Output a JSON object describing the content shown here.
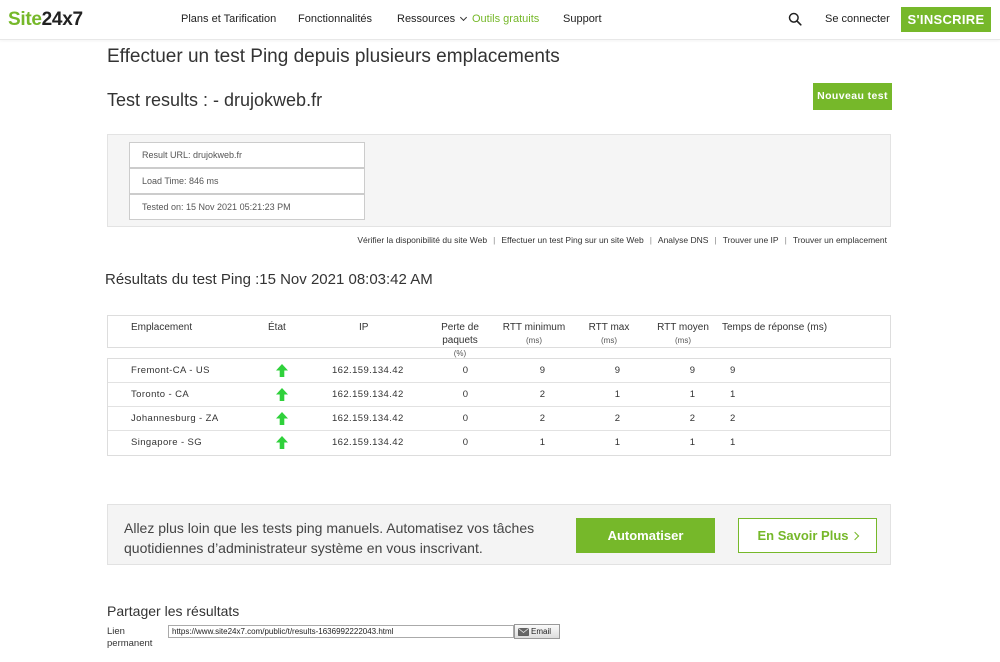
{
  "header": {
    "logo_part1": "Site",
    "logo_part2": "24x7",
    "nav": {
      "pricing": "Plans et Tarification",
      "features": "Fonctionnalités",
      "resources": "Ressources",
      "free_tools": "Outils gratuits",
      "support": "Support"
    },
    "signin": "Se connecter",
    "signup": "S'INSCRIRE",
    "accent_color": "#76b82a"
  },
  "page": {
    "title": "Effectuer un test Ping depuis plusieurs emplacements",
    "test_results_title": "Test results : - drujokweb.fr",
    "new_test_button": "Nouveau test"
  },
  "summary": {
    "result_url": "Result URL: drujokweb.fr",
    "load_time": "Load Time: 846 ms",
    "tested_on": "Tested on: 15 Nov 2021 05:21:23 PM"
  },
  "quicklinks": [
    "Vérifier la disponibilité du site Web",
    "Effectuer un test Ping sur un site Web",
    "Analyse DNS",
    "Trouver une IP",
    "Trouver un emplacement"
  ],
  "results": {
    "heading": "Résultats du test Ping :15 Nov 2021 08:03:42 AM",
    "columns": {
      "location": "Emplacement",
      "status": "État",
      "ip": "IP",
      "loss_l1": "Perte de",
      "loss_l2": "paquets",
      "loss_unit": "(%)",
      "rtt_min": "RTT minimum",
      "rtt_min_unit": "(ms)",
      "rtt_max": "RTT max",
      "rtt_max_unit": "(ms)",
      "rtt_avg": "RTT moyen",
      "rtt_avg_unit": "(ms)",
      "response": "Temps de réponse (ms)"
    },
    "rows": [
      {
        "location": "Fremont-CA - US",
        "status_icon": "up-arrow-icon",
        "ip": "162.159.134.42",
        "loss": "0",
        "rtt_min": "9",
        "rtt_max": "9",
        "rtt_avg": "9",
        "response": "9"
      },
      {
        "location": "Toronto - CA",
        "status_icon": "up-arrow-icon",
        "ip": "162.159.134.42",
        "loss": "0",
        "rtt_min": "2",
        "rtt_max": "1",
        "rtt_avg": "1",
        "response": "1"
      },
      {
        "location": "Johannesburg - ZA",
        "status_icon": "up-arrow-icon",
        "ip": "162.159.134.42",
        "loss": "0",
        "rtt_min": "2",
        "rtt_max": "2",
        "rtt_avg": "2",
        "response": "2"
      },
      {
        "location": "Singapore - SG",
        "status_icon": "up-arrow-icon",
        "ip": "162.159.134.42",
        "loss": "0",
        "rtt_min": "1",
        "rtt_max": "1",
        "rtt_avg": "1",
        "response": "1"
      }
    ]
  },
  "promo": {
    "text": "Allez plus loin que les tests ping manuels. Automatisez vos tâches quotidiennes d’administrateur système en vous inscrivant.",
    "automate_button": "Automatiser",
    "learn_more_button": "En Savoir Plus"
  },
  "share": {
    "title": "Partager les résultats",
    "permalink_label": "Lien permanent",
    "permalink_value": "https://www.site24x7.com/public/t/results-1636992222043.html",
    "email_button": "Email"
  }
}
